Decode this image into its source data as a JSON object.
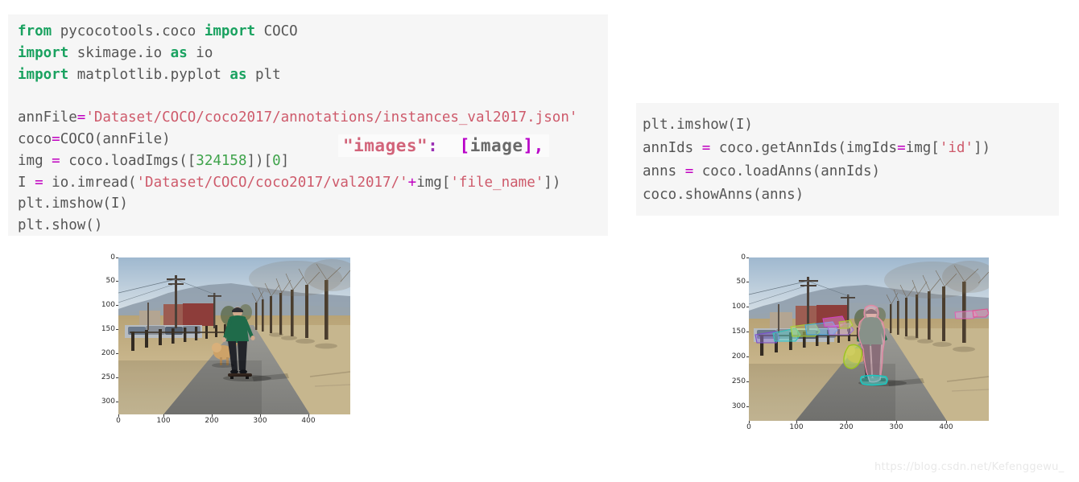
{
  "code_left": {
    "name": "python-code-load-image",
    "lines": [
      [
        {
          "t": "from ",
          "c": "kw"
        },
        {
          "t": "pycocotools.coco ",
          "c": "plain"
        },
        {
          "t": "import ",
          "c": "kw"
        },
        {
          "t": "COCO",
          "c": "plain"
        }
      ],
      [
        {
          "t": "import ",
          "c": "kw"
        },
        {
          "t": "skimage.io ",
          "c": "plain"
        },
        {
          "t": "as ",
          "c": "kw"
        },
        {
          "t": "io",
          "c": "plain"
        }
      ],
      [
        {
          "t": "import ",
          "c": "kw"
        },
        {
          "t": "matplotlib.pyplot ",
          "c": "plain"
        },
        {
          "t": "as ",
          "c": "kw"
        },
        {
          "t": "plt",
          "c": "plain"
        }
      ],
      [
        {
          "t": "",
          "c": "plain"
        }
      ],
      [
        {
          "t": "annFile",
          "c": "plain"
        },
        {
          "t": "=",
          "c": "op"
        },
        {
          "t": "'Dataset/COCO/coco2017/annotations/instances_val2017.json'",
          "c": "str"
        }
      ],
      [
        {
          "t": "coco",
          "c": "plain"
        },
        {
          "t": "=",
          "c": "op"
        },
        {
          "t": "COCO(annFile)",
          "c": "plain"
        }
      ],
      [
        {
          "t": "img ",
          "c": "plain"
        },
        {
          "t": "= ",
          "c": "op"
        },
        {
          "t": "coco.loadImgs([",
          "c": "plain"
        },
        {
          "t": "324158",
          "c": "num"
        },
        {
          "t": "])[",
          "c": "plain"
        },
        {
          "t": "0",
          "c": "num"
        },
        {
          "t": "]",
          "c": "plain"
        }
      ],
      [
        {
          "t": "I ",
          "c": "plain"
        },
        {
          "t": "= ",
          "c": "op"
        },
        {
          "t": "io.imread(",
          "c": "plain"
        },
        {
          "t": "'Dataset/COCO/coco2017/val2017/'",
          "c": "str"
        },
        {
          "t": "+",
          "c": "op"
        },
        {
          "t": "img[",
          "c": "plain"
        },
        {
          "t": "'file_name'",
          "c": "str"
        },
        {
          "t": "])",
          "c": "plain"
        }
      ],
      [
        {
          "t": "plt.imshow(I)",
          "c": "plain"
        }
      ],
      [
        {
          "t": "plt.show()",
          "c": "plain"
        }
      ]
    ]
  },
  "code_right": {
    "name": "python-code-show-annotations",
    "lines": [
      [
        {
          "t": "plt.imshow(I)",
          "c": "plain"
        }
      ],
      [
        {
          "t": "annIds ",
          "c": "plain"
        },
        {
          "t": "= ",
          "c": "op"
        },
        {
          "t": "coco.getAnnIds(imgIds",
          "c": "plain"
        },
        {
          "t": "=",
          "c": "op"
        },
        {
          "t": "img[",
          "c": "plain"
        },
        {
          "t": "'id'",
          "c": "str"
        },
        {
          "t": "])",
          "c": "plain"
        }
      ],
      [
        {
          "t": "anns ",
          "c": "plain"
        },
        {
          "t": "= ",
          "c": "op"
        },
        {
          "t": "coco.loadAnns(annIds)",
          "c": "plain"
        }
      ],
      [
        {
          "t": "coco.showAnns(anns)",
          "c": "plain"
        }
      ]
    ]
  },
  "overlay": {
    "key": "\"images\"",
    "colon": ":",
    "open_bracket": "[",
    "value": "image",
    "close_bracket": "],"
  },
  "figure_left": {
    "title": "",
    "alt": "COCO image 324158 - person skateboarding with dog on a paved path",
    "yticks": [
      "0",
      "50",
      "100",
      "150",
      "200",
      "250",
      "300"
    ],
    "xticks": [
      "0",
      "100",
      "200",
      "300",
      "400"
    ]
  },
  "figure_right": {
    "title": "",
    "alt": "COCO image 324158 with segmentation masks overlaid",
    "yticks": [
      "0",
      "50",
      "100",
      "150",
      "200",
      "250",
      "300"
    ],
    "xticks": [
      "0",
      "100",
      "200",
      "300",
      "400"
    ],
    "mask_colors": {
      "person": "#f0b8c8",
      "dog": "#c4e64a",
      "skateboard": "#46e0d8",
      "car_1": "#9a7ede",
      "car_2": "#5ad8d0",
      "car_3": "#7ec8f0",
      "car_4": "#d87edc",
      "car_5": "#c8e870"
    }
  },
  "chart_data": {
    "type": "image",
    "xlabel": "",
    "ylabel": "",
    "xlim": [
      0,
      480
    ],
    "ylim": [
      320,
      0
    ],
    "grid": false
  },
  "watermark": {
    "text": "https://blog.csdn.net/Kefenggewu_"
  }
}
